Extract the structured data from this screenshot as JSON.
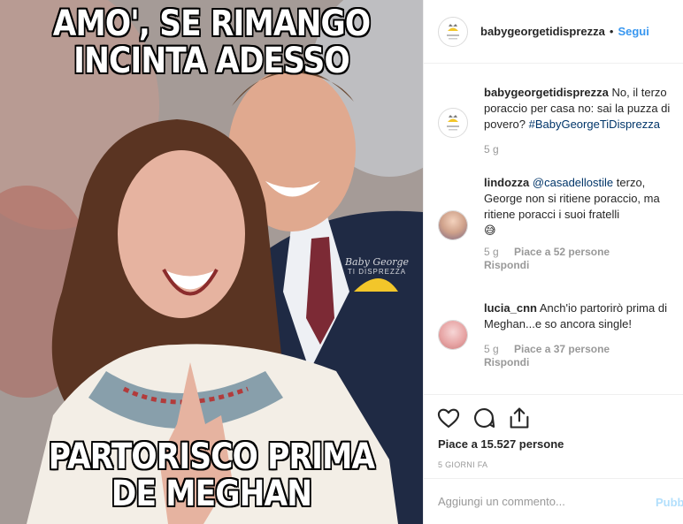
{
  "meme": {
    "top_line1": "AMO', SE RIMANGO",
    "top_line2": "INCINTA ADESSO",
    "bottom_line1": "PARTORISCO PRIMA",
    "bottom_line2": "DE MEGHAN",
    "watermark_line1": "Baby George",
    "watermark_line2": "TI DISPREZZA"
  },
  "header": {
    "username": "babygeorgetidisprezza",
    "separator": "•",
    "follow_label": "Segui"
  },
  "caption": {
    "author": "babygeorgetidisprezza",
    "text": "No, il terzo poraccio per casa no: sai la puzza di povero?",
    "hashtag": "#BabyGeorgeTiDisprezza",
    "time": "5 g"
  },
  "comments": [
    {
      "author": "lindozza",
      "mention": "@casadellostile",
      "text": "terzo, George non si ritiene poraccio, ma ritiene poracci i suoi fratelli",
      "emoji": "😅",
      "time": "5 g",
      "likes": "Piace a 52 persone",
      "reply": "Rispondi"
    },
    {
      "author": "lucia_cnn",
      "text": "Anch'io partorirò prima di Meghan...e so ancora single!",
      "time": "5 g",
      "likes": "Piace a 37 persone",
      "reply": "Rispondi"
    }
  ],
  "actions": {
    "like_icon": "heart-icon",
    "comment_icon": "comment-icon",
    "share_icon": "share-icon",
    "likes_count": "Piace a 15.527 persone",
    "date": "5 GIORNI FA"
  },
  "add_comment": {
    "placeholder": "Aggiungi un commento...",
    "publish_label": "Pubblica"
  },
  "colors": {
    "accent_blue": "#3897f0",
    "link_dark_blue": "#003569",
    "meta_gray": "#999999",
    "border": "#efefef"
  }
}
